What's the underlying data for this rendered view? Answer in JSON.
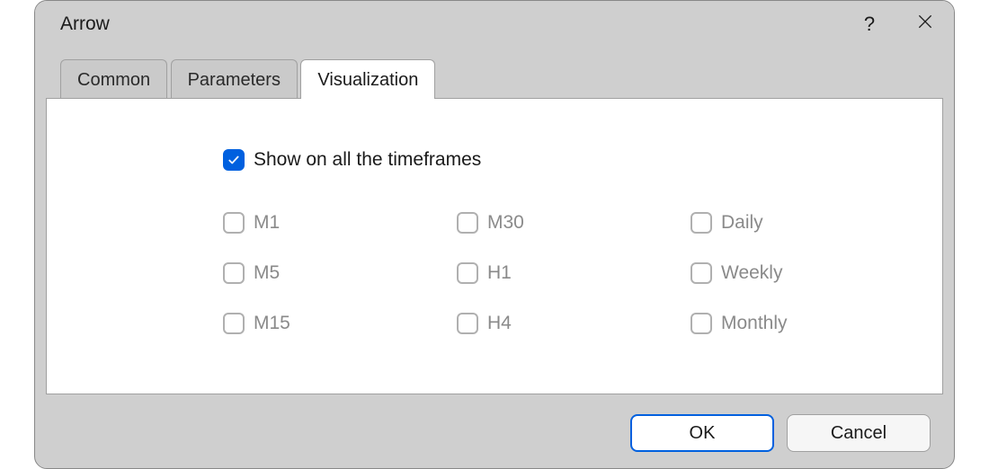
{
  "window": {
    "title": "Arrow"
  },
  "tabs": {
    "common": "Common",
    "parameters": "Parameters",
    "visualization": "Visualization"
  },
  "show_all": {
    "label": "Show on all the timeframes",
    "checked": true
  },
  "timeframes": [
    {
      "key": "m1",
      "label": "M1",
      "checked": false
    },
    {
      "key": "m5",
      "label": "M5",
      "checked": false
    },
    {
      "key": "m15",
      "label": "M15",
      "checked": false
    },
    {
      "key": "m30",
      "label": "M30",
      "checked": false
    },
    {
      "key": "h1",
      "label": "H1",
      "checked": false
    },
    {
      "key": "h4",
      "label": "H4",
      "checked": false
    },
    {
      "key": "d",
      "label": "Daily",
      "checked": false
    },
    {
      "key": "w",
      "label": "Weekly",
      "checked": false
    },
    {
      "key": "mn",
      "label": "Monthly",
      "checked": false
    }
  ],
  "buttons": {
    "ok": "OK",
    "cancel": "Cancel"
  },
  "colors": {
    "accent": "#0060df",
    "dialog_bg": "#cfcfcf",
    "panel_bg": "#ffffff",
    "disabled_text": "#8a8a8a"
  }
}
